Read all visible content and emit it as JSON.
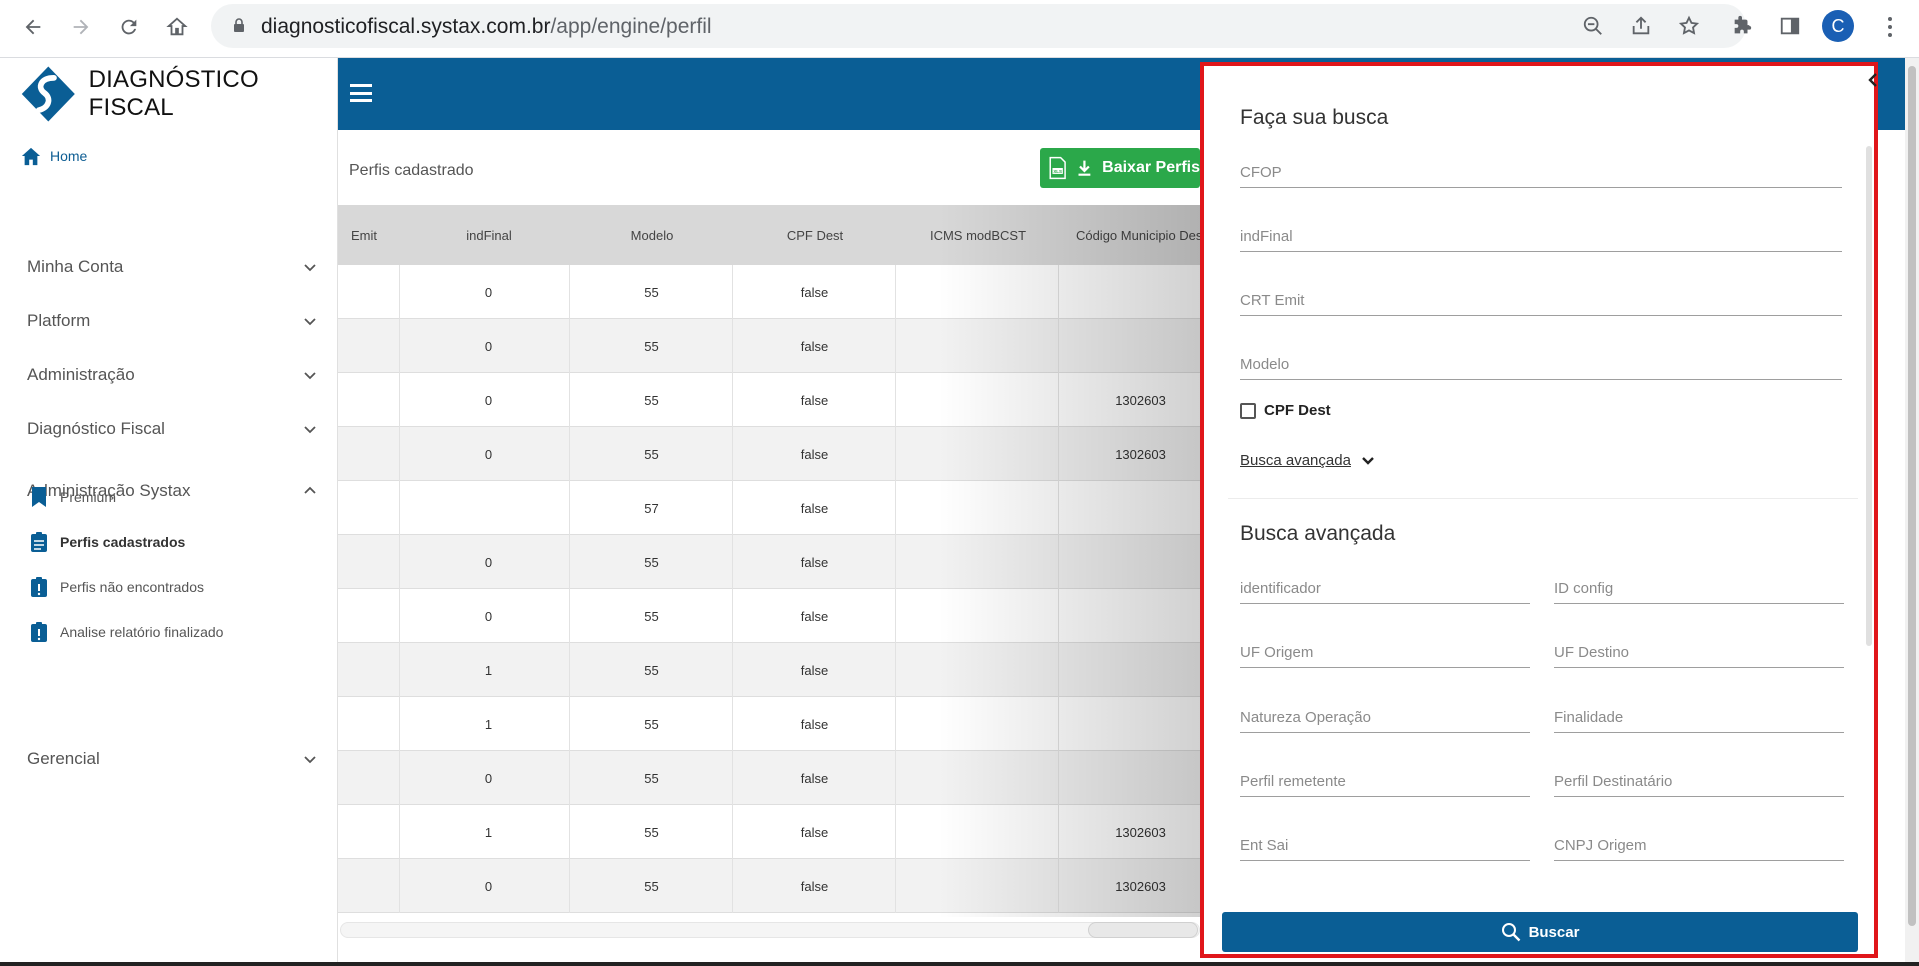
{
  "browser": {
    "url_host": "diagnosticofiscal.systax.com.br",
    "url_path": "/app/engine/perfil",
    "profile_initial": "C"
  },
  "sidebar": {
    "brand": "DIAGNÓSTICO FISCAL",
    "home": "Home",
    "sections": [
      "Minha Conta",
      "Platform",
      "Administração",
      "Diagnóstico Fiscal",
      "Administração Systax",
      "Gerencial"
    ],
    "sub_items": [
      "Premium",
      "Perfis cadastrados",
      "Perfis não encontrados",
      "Analise relatório finalizado"
    ]
  },
  "main": {
    "page_label": "Perfis cadastrado",
    "export_button": "Baixar Perfis",
    "table": {
      "headers": [
        "Emit",
        "indFinal",
        "Modelo",
        "CPF Dest",
        "ICMS modBCST",
        "Código Municipio Dest"
      ],
      "rows": [
        [
          "",
          "0",
          "55",
          "false",
          "",
          ""
        ],
        [
          "",
          "0",
          "55",
          "false",
          "",
          ""
        ],
        [
          "",
          "0",
          "55",
          "false",
          "",
          "1302603"
        ],
        [
          "",
          "0",
          "55",
          "false",
          "",
          "1302603"
        ],
        [
          "",
          "",
          "57",
          "false",
          "",
          ""
        ],
        [
          "",
          "0",
          "55",
          "false",
          "",
          ""
        ],
        [
          "",
          "0",
          "55",
          "false",
          "",
          ""
        ],
        [
          "",
          "1",
          "55",
          "false",
          "",
          ""
        ],
        [
          "",
          "1",
          "55",
          "false",
          "",
          ""
        ],
        [
          "",
          "0",
          "55",
          "false",
          "",
          ""
        ],
        [
          "",
          "1",
          "55",
          "false",
          "",
          "1302603"
        ],
        [
          "",
          "0",
          "55",
          "false",
          "",
          "1302603"
        ]
      ]
    }
  },
  "drawer": {
    "title": "Faça sua busca",
    "fields": [
      "CFOP",
      "indFinal",
      "CRT Emit",
      "Modelo"
    ],
    "checkbox_label": "CPF Dest",
    "advanced_toggle": "Busca avançada",
    "advanced_title": "Busca avançada",
    "advanced_fields": [
      [
        "identificador",
        "ID config"
      ],
      [
        "UF Origem",
        "UF Destino"
      ],
      [
        "Natureza Operação",
        "Finalidade"
      ],
      [
        "Perfil remetente",
        "Perfil Destinatário"
      ],
      [
        "Ent Sai",
        "CNPJ Origem"
      ]
    ],
    "search_button": "Buscar"
  },
  "colors": {
    "brand_blue": "#0a5e95",
    "export_green": "#2ba84a",
    "highlight_red": "#e0161a"
  }
}
